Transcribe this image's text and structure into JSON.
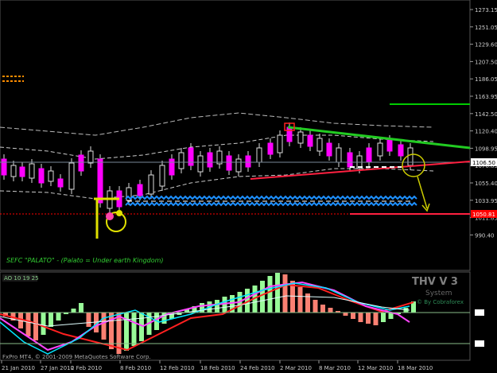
{
  "platform": {
    "copyright": "FxPro MT4, © 2001-2009 MetaQuotes Software Corp."
  },
  "main_panel": {
    "annotation": "SEFC \"PALATO\" - (Palato = Under earth Kingdom)",
    "price_ticks": [
      "1273.15",
      "1251.05",
      "1229.60",
      "1207.50",
      "1186.05",
      "1163.95",
      "1142.50",
      "1120.40",
      "1098.95",
      "1076.85",
      "1055.40",
      "1033.95",
      "1011.85",
      "990.40"
    ],
    "current_price": "1106.50",
    "support_price": "1050.81"
  },
  "indicator_panel": {
    "label": "AO 10 19 25",
    "title": "THV V 3",
    "subtitle": "System",
    "credit": "© By Cobraforex"
  },
  "time_axis": {
    "labels": [
      "21 Jan 2010",
      "27 Jan 2010",
      "2 Feb 2010",
      "8 Feb 2010",
      "12 Feb 2010",
      "18 Feb 2010",
      "24 Feb 2010",
      "2 Mar 2010",
      "8 Mar 2010",
      "12 Mar 2010",
      "18 Mar 2010"
    ]
  },
  "colors": {
    "background": "#000000",
    "candle_up": "#ff00ff",
    "candle_down": "#ff00ff",
    "hist_up": "#98fb98",
    "hist_down": "#fa8072",
    "support_line": "#ff0000",
    "green_line": "#00cc00"
  }
}
